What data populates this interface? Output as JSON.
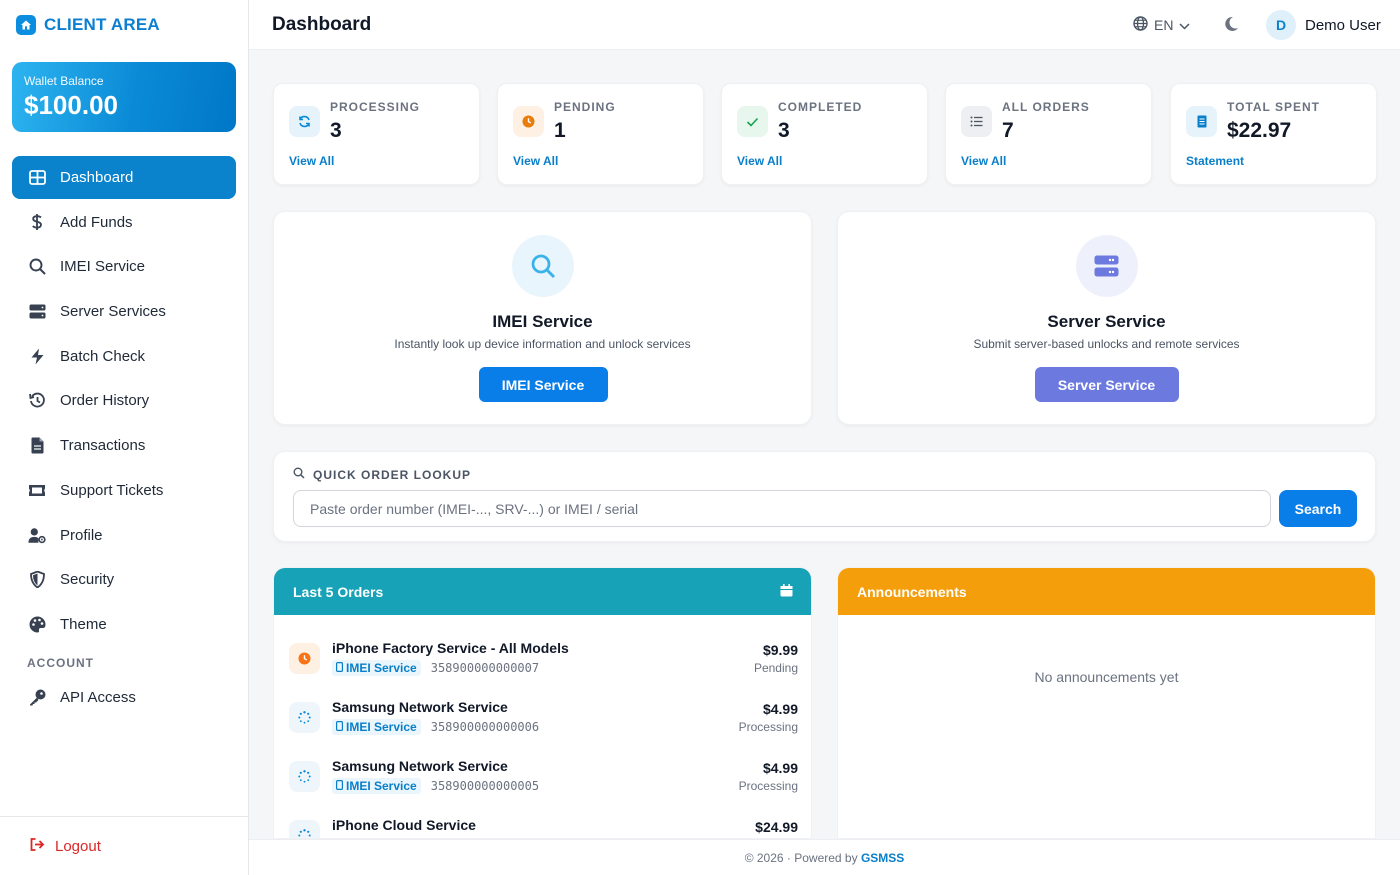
{
  "brand": {
    "name": "CLIENT AREA"
  },
  "wallet": {
    "label": "Wallet Balance",
    "amount": "$100.00"
  },
  "nav": {
    "items": [
      {
        "label": "Dashboard",
        "icon": "grid-icon",
        "active": true
      },
      {
        "label": "Add Funds",
        "icon": "dollar-icon"
      },
      {
        "label": "IMEI Service",
        "icon": "search-icon"
      },
      {
        "label": "Server Services",
        "icon": "server-icon"
      },
      {
        "label": "Batch Check",
        "icon": "bolt-icon"
      },
      {
        "label": "Order History",
        "icon": "history-icon"
      },
      {
        "label": "Transactions",
        "icon": "file-icon"
      },
      {
        "label": "Support Tickets",
        "icon": "ticket-icon"
      },
      {
        "label": "Profile",
        "icon": "user-gear-icon"
      },
      {
        "label": "Security",
        "icon": "shield-icon"
      },
      {
        "label": "Theme",
        "icon": "palette-icon"
      }
    ],
    "section_account": "ACCOUNT",
    "account_items": [
      {
        "label": "API Access",
        "icon": "key-icon"
      }
    ],
    "logout": "Logout"
  },
  "header": {
    "title": "Dashboard",
    "language": "EN",
    "user_initial": "D",
    "user_name": "Demo User"
  },
  "stats": [
    {
      "label": "PROCESSING",
      "value": "3",
      "link": "View All",
      "color": "#0a8ad6"
    },
    {
      "label": "PENDING",
      "value": "1",
      "link": "View All",
      "color": "#f97316"
    },
    {
      "label": "COMPLETED",
      "value": "3",
      "link": "View All",
      "color": "#16a34a"
    },
    {
      "label": "ALL ORDERS",
      "value": "7",
      "link": "View All",
      "color": "#4b5563"
    },
    {
      "label": "TOTAL SPENT",
      "value": "$22.97",
      "link": "Statement",
      "color": "#0a7fc9"
    }
  ],
  "services": {
    "imei": {
      "title": "IMEI Service",
      "description": "Instantly look up device information and unlock services",
      "button": "IMEI Service",
      "color": "#0a7ee8"
    },
    "server": {
      "title": "Server Service",
      "description": "Submit server-based unlocks and remote services",
      "button": "Server Service",
      "color": "#6c7ae0"
    }
  },
  "lookup": {
    "label": "QUICK ORDER LOOKUP",
    "placeholder": "Paste order number (IMEI-..., SRV-...) or IMEI / serial",
    "button": "Search"
  },
  "orders": {
    "title": "Last 5 Orders",
    "items": [
      {
        "name": "iPhone Factory Service - All Models",
        "tag": "IMEI Service",
        "imei": "358900000000007",
        "price": "$9.99",
        "status": "Pending",
        "state": "pending"
      },
      {
        "name": "Samsung Network Service",
        "tag": "IMEI Service",
        "imei": "358900000000006",
        "price": "$4.99",
        "status": "Processing",
        "state": "processing"
      },
      {
        "name": "Samsung Network Service",
        "tag": "IMEI Service",
        "imei": "358900000000005",
        "price": "$4.99",
        "status": "Processing",
        "state": "processing"
      },
      {
        "name": "iPhone Cloud Service",
        "tag": "",
        "imei": "",
        "price": "$24.99",
        "status": "",
        "state": "processing"
      }
    ]
  },
  "announcements": {
    "title": "Announcements",
    "empty": "No announcements yet"
  },
  "footer": {
    "text": "© 2026 · Powered by",
    "brand": "GSMSS"
  }
}
